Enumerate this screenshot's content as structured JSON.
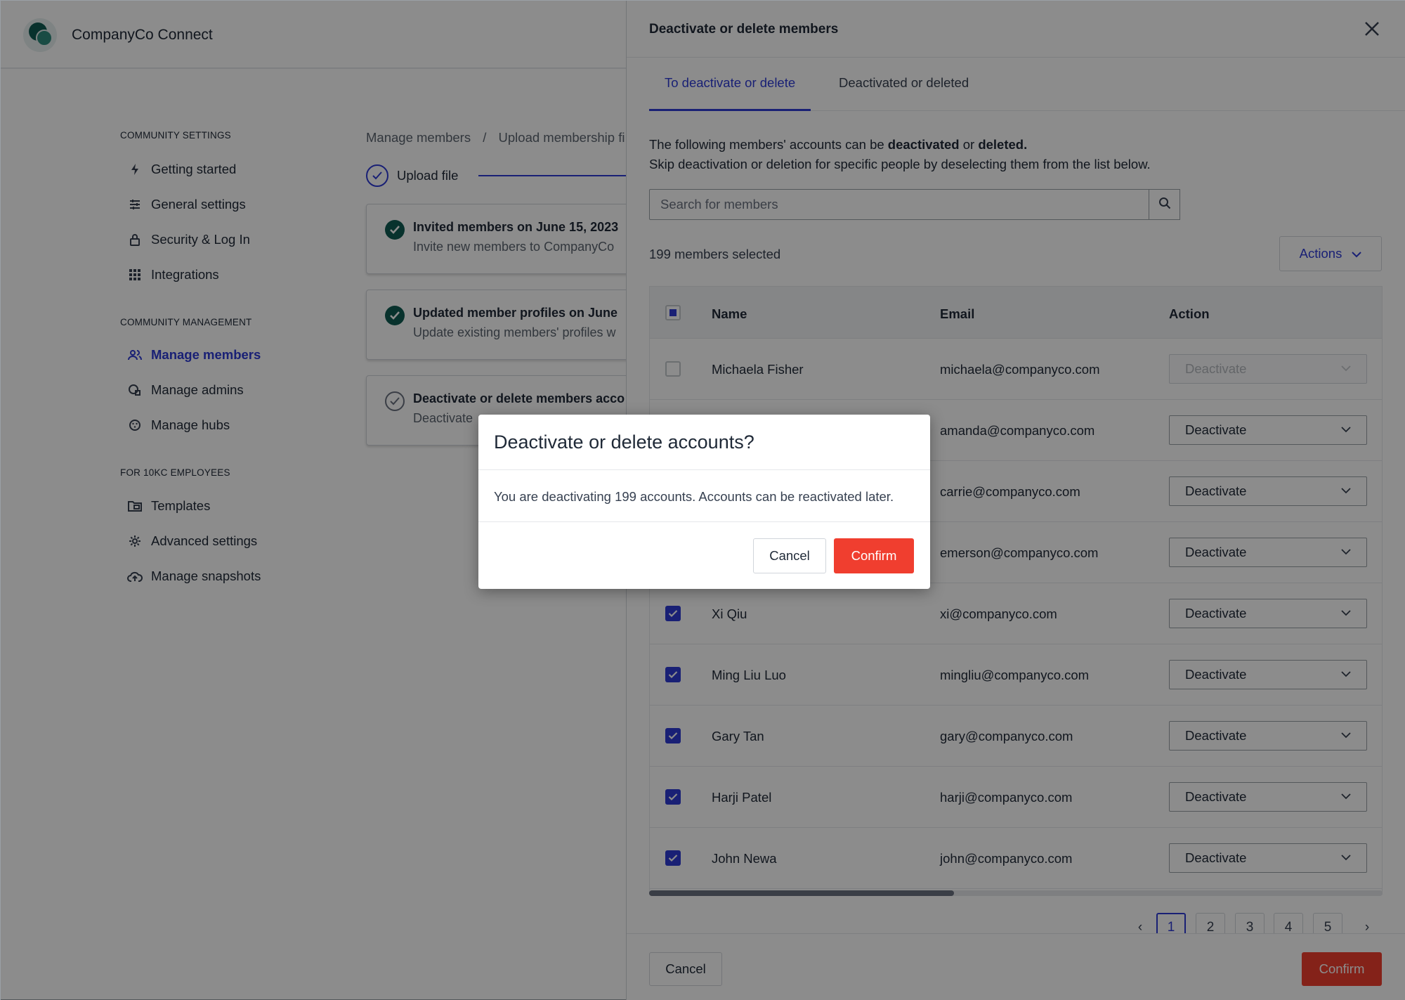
{
  "app": {
    "title": "CompanyCo Connect"
  },
  "sidebar": {
    "sections": [
      {
        "title": "COMMUNITY SETTINGS",
        "items": [
          {
            "label": "Getting started",
            "icon": "bolt-icon"
          },
          {
            "label": "General settings",
            "icon": "sliders-icon"
          },
          {
            "label": "Security & Log In",
            "icon": "lock-icon"
          },
          {
            "label": "Integrations",
            "icon": "grid-icon"
          }
        ]
      },
      {
        "title": "COMMUNITY MANAGEMENT",
        "items": [
          {
            "label": "Manage members",
            "icon": "users-icon",
            "active": true
          },
          {
            "label": "Manage admins",
            "icon": "admin-icon"
          },
          {
            "label": "Manage hubs",
            "icon": "hubs-icon"
          }
        ]
      },
      {
        "title": "FOR 10KC EMPLOYEES",
        "items": [
          {
            "label": "Templates",
            "icon": "folder-icon"
          },
          {
            "label": "Advanced settings",
            "icon": "gear-icon"
          },
          {
            "label": "Manage snapshots",
            "icon": "cloud-upload-icon"
          }
        ]
      }
    ]
  },
  "main": {
    "breadcrumb": [
      "Manage members",
      "/",
      "Upload membership fi"
    ],
    "step_label": "Upload file",
    "cards": [
      {
        "title": "Invited members on June 15, 2023",
        "subtitle": "Invite new members to CompanyCo",
        "status": "done"
      },
      {
        "title": "Updated member profiles on June",
        "subtitle": "Update existing members' profiles w",
        "status": "done"
      },
      {
        "title": "Deactivate or delete members acco",
        "subtitle": "Deactivate",
        "status": "pending"
      }
    ]
  },
  "panel": {
    "title": "Deactivate or delete members",
    "tabs": [
      {
        "label": "To deactivate or delete",
        "active": true
      },
      {
        "label": "Deactivated or deleted",
        "active": false
      }
    ],
    "description": {
      "line1_prefix": "The following members' accounts can be ",
      "line1_bold1": "deactivated",
      "line1_mid": " or ",
      "line1_bold2": "deleted.",
      "line2": "Skip deactivation or deletion for specific people by deselecting them from the list below."
    },
    "search": {
      "placeholder": "Search for members"
    },
    "selected_count": "199 members selected",
    "actions_label": "Actions",
    "table": {
      "columns": [
        "Name",
        "Email",
        "Action"
      ],
      "rows": [
        {
          "name": "Michaela Fisher",
          "email": "michaela@companyco.com",
          "action": "Deactivate",
          "checked": false
        },
        {
          "name": "",
          "email": "amanda@companyco.com",
          "action": "Deactivate",
          "checked": true
        },
        {
          "name": "",
          "email": "carrie@companyco.com",
          "action": "Deactivate",
          "checked": true
        },
        {
          "name": "",
          "email": "emerson@companyco.com",
          "action": "Deactivate",
          "checked": true
        },
        {
          "name": "Xi Qiu",
          "email": "xi@companyco.com",
          "action": "Deactivate",
          "checked": true
        },
        {
          "name": "Ming Liu Luo",
          "email": "mingliu@companyco.com",
          "action": "Deactivate",
          "checked": true
        },
        {
          "name": "Gary Tan",
          "email": "gary@companyco.com",
          "action": "Deactivate",
          "checked": true
        },
        {
          "name": "Harji Patel",
          "email": "harji@companyco.com",
          "action": "Deactivate",
          "checked": true
        },
        {
          "name": "John Newa",
          "email": "john@companyco.com",
          "action": "Deactivate",
          "checked": true
        }
      ]
    },
    "pagination": {
      "pages": [
        "1",
        "2",
        "3",
        "4",
        "5"
      ],
      "current": "1",
      "prev": "‹",
      "next": "›"
    },
    "footer": {
      "cancel_label": "Cancel",
      "confirm_label": "Confirm"
    }
  },
  "modal": {
    "title": "Deactivate or delete accounts?",
    "body": "You are deactivating 199 accounts. Accounts can be reactivated later.",
    "cancel_label": "Cancel",
    "confirm_label": "Confirm"
  },
  "colors": {
    "accent": "#2e3bd6",
    "danger": "#f03e2f",
    "brand": "#0f5c52"
  }
}
